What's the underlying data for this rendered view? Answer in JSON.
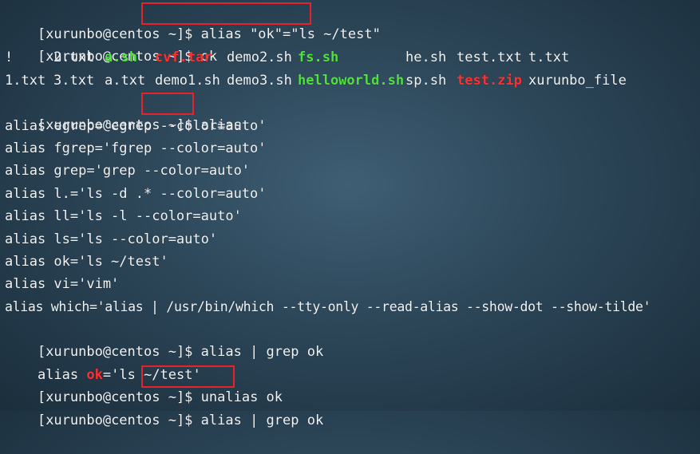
{
  "prompt": "[xurunbo@centos ~]$ ",
  "commands": {
    "c1": "alias \"ok\"=\"ls ~/test\"",
    "c2": "ok",
    "c3": "alias",
    "c4": "alias | grep ok",
    "c5": "unalias ok",
    "c6": "alias | grep ok"
  },
  "ls_output": {
    "row1": [
      "!",
      "2.txt",
      "a.sh",
      "cvf.tar",
      "demo2.sh",
      "fs.sh",
      "he.sh",
      "test.txt",
      "t.txt"
    ],
    "row2": [
      "1.txt",
      "3.txt",
      "a.txt",
      "demo1.sh",
      "demo3.sh",
      "helloworld.sh",
      "sp.sh",
      "test.zip",
      "xurunbo_file"
    ]
  },
  "alias_list": [
    "alias egrep='egrep --color=auto'",
    "alias fgrep='fgrep --color=auto'",
    "alias grep='grep --color=auto'",
    "alias l.='ls -d .* --color=auto'",
    "alias ll='ls -l --color=auto'",
    "alias ls='ls --color=auto'",
    "alias ok='ls ~/test'",
    "alias vi='vim'",
    "alias which='alias | /usr/bin/which --tty-only --read-alias --show-dot --show-tilde'"
  ],
  "grep_result": {
    "before": "alias ",
    "match": "ok",
    "after": "='ls ~/test'"
  },
  "colors": {
    "executable": "#4fe23c",
    "archive": "#ff3030",
    "highlight_box": "#e8222a"
  }
}
